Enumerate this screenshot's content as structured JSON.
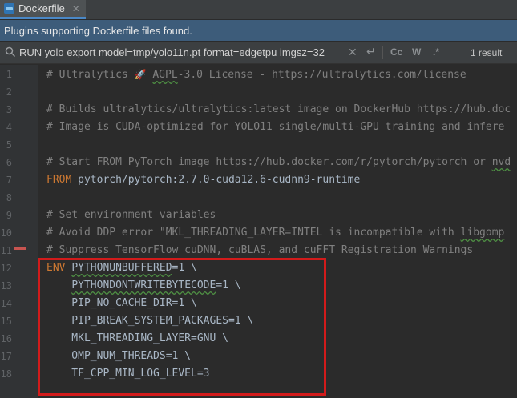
{
  "tab": {
    "title": "Dockerfile",
    "close": "✕"
  },
  "banner": {
    "text": "Plugins supporting Dockerfile files found."
  },
  "search": {
    "query": "RUN yolo export model=tmp/yolo11n.pt format=edgetpu imgsz=32",
    "match_case": "Cc",
    "words": "W",
    "regex": ".*",
    "result_count": "1 result"
  },
  "editor": {
    "lines": [
      {
        "n": "1",
        "parts": [
          [
            "comment",
            "# Ultralytics "
          ],
          [
            "rocket",
            "🚀"
          ],
          [
            "comment",
            " "
          ],
          [
            "comment-warn",
            "AGPL"
          ],
          [
            "comment",
            "-3.0 License - https://ultralytics.com/license"
          ]
        ]
      },
      {
        "n": "2",
        "parts": []
      },
      {
        "n": "3",
        "parts": [
          [
            "comment",
            "# Builds ultralytics/ultralytics:latest image on DockerHub https://hub.doc"
          ]
        ]
      },
      {
        "n": "4",
        "parts": [
          [
            "comment",
            "# Image is CUDA-optimized for YOLO11 single/multi-GPU training and infere"
          ]
        ]
      },
      {
        "n": "5",
        "parts": []
      },
      {
        "n": "6",
        "parts": [
          [
            "comment",
            "# Start FROM PyTorch image https://hub.docker.com/r/pytorch/pytorch or "
          ],
          [
            "comment-warn",
            "nvd"
          ]
        ]
      },
      {
        "n": "7",
        "parts": [
          [
            "kw",
            "FROM"
          ],
          [
            "plain",
            " pytorch/pytorch:2.7.0-cuda12.6-cudnn9-runtime"
          ]
        ]
      },
      {
        "n": "8",
        "parts": []
      },
      {
        "n": "9",
        "parts": [
          [
            "comment",
            "# Set environment variables"
          ]
        ]
      },
      {
        "n": "10",
        "parts": [
          [
            "comment",
            "# Avoid DDP error \"MKL_THREADING_LAYER=INTEL is incompatible with "
          ],
          [
            "comment-warn",
            "libgomp"
          ]
        ]
      },
      {
        "n": "11",
        "parts": [
          [
            "comment",
            "# Suppress TensorFlow cuDNN, cuBLAS, and cuFFT Registration Warnings"
          ]
        ]
      },
      {
        "n": "12",
        "parts": [
          [
            "kw",
            "ENV"
          ],
          [
            "plain",
            " "
          ],
          [
            "plain-warn",
            "PYTHONUNBUFFERED"
          ],
          [
            "plain",
            "=1 \\"
          ]
        ]
      },
      {
        "n": "13",
        "parts": [
          [
            "plain",
            "    "
          ],
          [
            "plain-warn",
            "PYTHONDONTWRITEBYTECODE"
          ],
          [
            "plain",
            "=1 \\"
          ]
        ]
      },
      {
        "n": "14",
        "parts": [
          [
            "plain",
            "    PIP_NO_CACHE_DIR=1 \\"
          ]
        ]
      },
      {
        "n": "15",
        "parts": [
          [
            "plain",
            "    PIP_BREAK_SYSTEM_PACKAGES=1 \\"
          ]
        ]
      },
      {
        "n": "16",
        "parts": [
          [
            "plain",
            "    MKL_THREADING_LAYER=GNU \\"
          ]
        ]
      },
      {
        "n": "17",
        "parts": [
          [
            "plain",
            "    OMP_NUM_THREADS=1 \\"
          ]
        ]
      },
      {
        "n": "18",
        "parts": [
          [
            "plain",
            "    TF_CPP_MIN_LOG_LEVEL=3"
          ]
        ]
      }
    ]
  },
  "colors": {
    "background": "#2b2b2b",
    "comment": "#808080",
    "keyword": "#cc7832",
    "text": "#a9b7c6",
    "highlight_box": "#d21b1b",
    "banner": "#3d5c7a"
  }
}
